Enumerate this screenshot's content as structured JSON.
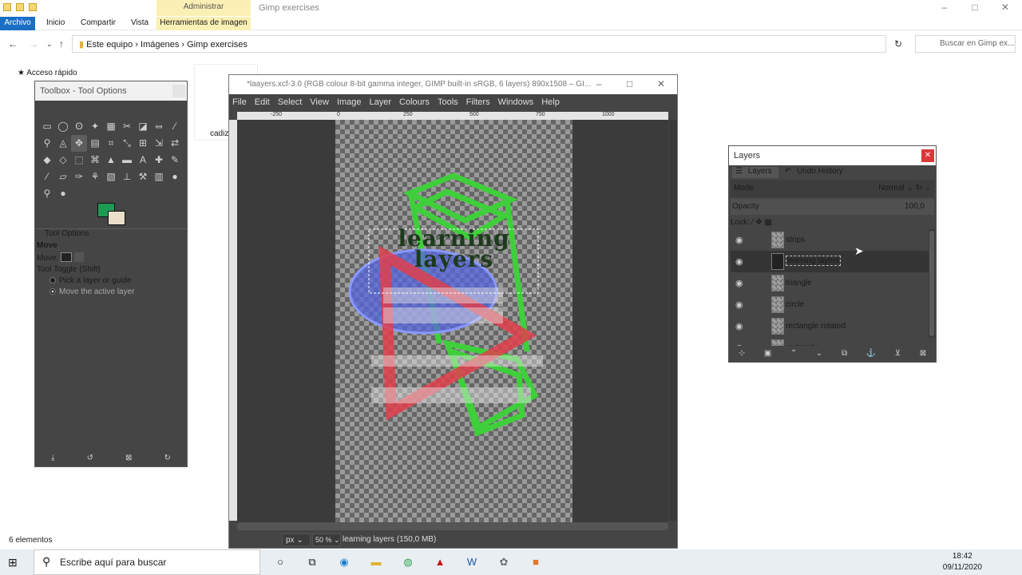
{
  "explorer": {
    "manage_tab": "Administrar",
    "window_title": "Gimp exercises",
    "ribbon": {
      "file": "Archivo",
      "home": "Inicio",
      "share": "Compartir",
      "view": "Vista",
      "image_tools": "Herramientas de imagen"
    },
    "breadcrumbs": [
      "Este equipo",
      "Imágenes",
      "Gimp exercises"
    ],
    "search_placeholder": "Buscar en Gimp ex...",
    "quick_access": "Acceso rápido",
    "file_partial": "cadiz",
    "status": "6 elementos"
  },
  "toolbox": {
    "title": "Toolbox - Tool Options",
    "tool_options_header": "Tool Options",
    "tool_name": "Move",
    "move_label": "Move:",
    "toggle_label": "Tool Toggle  (Shift)",
    "option_1": "Pick a layer or guide",
    "option_2": "Move the active layer",
    "fg_color": "#1f9a55",
    "bg_color": "#eadfca"
  },
  "image_window": {
    "title": "*laayers.xcf-3.0 (RGB colour 8-bit gamma integer, GIMP built-in sRGB, 6 layers) 890x1508 – GI...",
    "menu": [
      "File",
      "Edit",
      "Select",
      "View",
      "Image",
      "Layer",
      "Colours",
      "Tools",
      "Filters",
      "Windows",
      "Help"
    ],
    "ruler_marks": [
      "-250",
      "0",
      "250",
      "500",
      "750",
      "1000"
    ],
    "canvas_text_1": "learning",
    "canvas_text_2": "layers",
    "unit": "px",
    "zoom": "50 %",
    "status": "learning layers (150,0 MB)"
  },
  "layers_dialog": {
    "title": "Layers",
    "tab_layers": "Layers",
    "tab_undo": "Undo History",
    "mode_label": "Mode",
    "mode_value": "Normal",
    "opacity_label": "Opacity",
    "opacity_value": "100,0",
    "lock_label": "Lock:",
    "layers": [
      "strips",
      "learning layers",
      "triangle",
      "circle",
      "rectangle rotated",
      "rectangle"
    ],
    "selected_layer": "learning layers"
  },
  "taskbar": {
    "search_placeholder": "Escribe aquí para buscar",
    "time": "18:42",
    "date": "09/11/2020"
  }
}
